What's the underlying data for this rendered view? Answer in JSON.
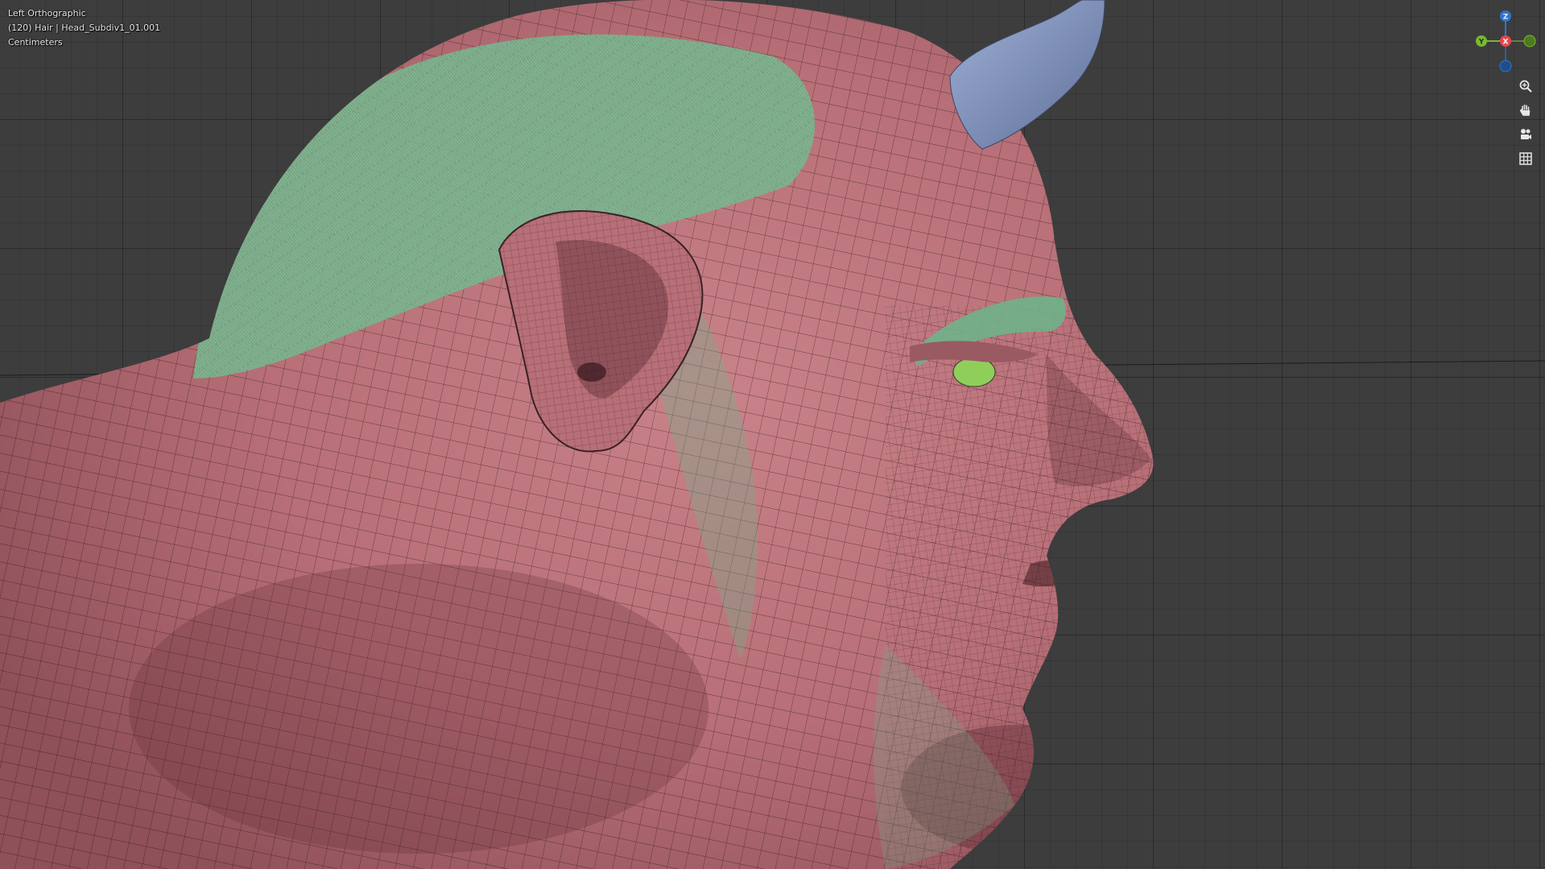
{
  "viewport": {
    "view_name": "Left Orthographic",
    "object_info": "(120) Hair | Head_Subdiv1_01.001",
    "units": "Centimeters"
  },
  "gizmo": {
    "z_label": "Z",
    "y_label": "Y",
    "x_label": "X",
    "colors": {
      "x": "#e8444e",
      "y": "#7ab833",
      "z": "#2f75c9"
    }
  },
  "nav_tools": [
    {
      "name": "zoom-icon",
      "tooltip": ""
    },
    {
      "name": "hand-icon",
      "tooltip": ""
    },
    {
      "name": "camera-icon",
      "tooltip": ""
    },
    {
      "name": "grid-icon",
      "tooltip": ""
    }
  ],
  "colors": {
    "background": "#3d3d3d",
    "skin": "#b96f77",
    "hair": "#6fb28a",
    "horn": "#7c8fb8",
    "eye": "#8fcf59"
  }
}
